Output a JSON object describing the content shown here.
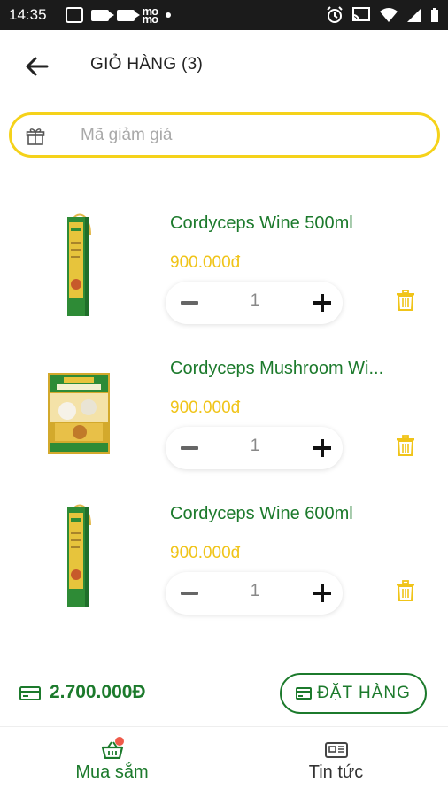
{
  "status_bar": {
    "time": "14:35",
    "momo_text": "mo\nmo"
  },
  "header": {
    "title": "GIỎ HÀNG (3)",
    "back_icon": "arrow-left-icon"
  },
  "coupon": {
    "placeholder": "Mã giảm giá",
    "value": "",
    "icon": "gift-icon"
  },
  "cart": {
    "items": [
      {
        "name": "Cordyceps Wine 500ml",
        "price": "900.000đ",
        "quantity": "1"
      },
      {
        "name": "Cordyceps Mushroom Wi...",
        "price": "900.000đ",
        "quantity": "1"
      },
      {
        "name": "Cordyceps Wine 600ml",
        "price": "900.000đ",
        "quantity": "1"
      }
    ]
  },
  "summary": {
    "total": "2.700.000Đ",
    "order_label": "ĐẶT HÀNG"
  },
  "bottom_nav": {
    "items": [
      {
        "label": "Mua sắm",
        "icon": "basket-icon",
        "active": true
      },
      {
        "label": "Tin tức",
        "icon": "newspaper-icon",
        "active": false
      }
    ]
  },
  "colors": {
    "brand_green": "#1c7a2c",
    "accent_yellow": "#f0c419",
    "badge_red": "#ef5a4a"
  }
}
